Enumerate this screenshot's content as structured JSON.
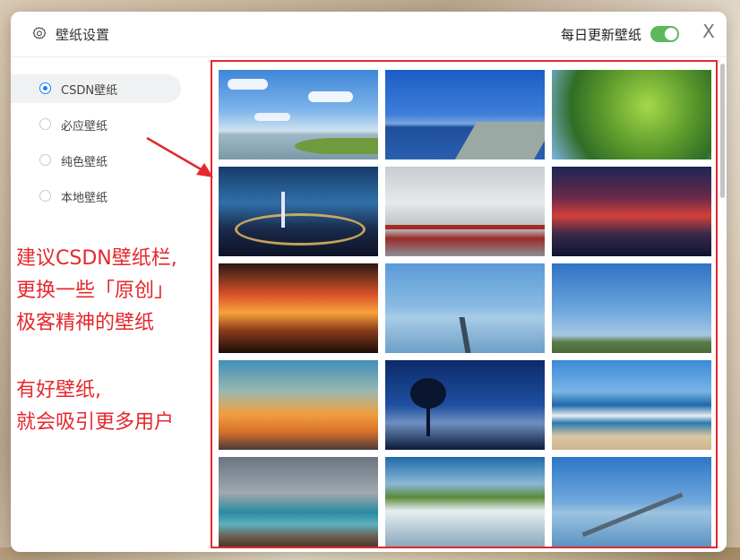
{
  "header": {
    "title": "壁纸设置",
    "daily_update_label": "每日更新壁纸",
    "daily_update_enabled": true,
    "close_glyph": "X"
  },
  "sidebar": {
    "items": [
      {
        "label": "CSDN壁纸",
        "selected": true
      },
      {
        "label": "必应壁纸",
        "selected": false
      },
      {
        "label": "纯色壁纸",
        "selected": false
      },
      {
        "label": "本地壁纸",
        "selected": false
      }
    ]
  },
  "annotation": {
    "lines": [
      "建议CSDN壁纸栏,",
      "更换一些「原创」",
      "极客精神的壁纸",
      "",
      "有好壁纸,",
      "就会吸引更多用户"
    ],
    "color": "#e4282d"
  },
  "gallery": {
    "thumbnails": [
      {
        "scene": "blue sky clouds over lake with reeds"
      },
      {
        "scene": "blue lake with shoreline road"
      },
      {
        "scene": "ginkgo leaves against sky"
      },
      {
        "scene": "night city interchange lights"
      },
      {
        "scene": "chinese pavilion red railing misty"
      },
      {
        "scene": "anime girl under red sunset clouds"
      },
      {
        "scene": "orange sunset with tree silhouettes"
      },
      {
        "scene": "bridge across calm sea"
      },
      {
        "scene": "blue sky with green hills"
      },
      {
        "scene": "orange sunset sky with contrail"
      },
      {
        "scene": "tree silhouette blue dusk"
      },
      {
        "scene": "beach waves with seagull"
      },
      {
        "scene": "stormy sea rocky coast"
      },
      {
        "scene": "island above clouds"
      },
      {
        "scene": "long bridge over blue sea"
      }
    ]
  },
  "colors": {
    "accent": "#1e7cf2",
    "toggle_on": "#5cb85c",
    "highlight_border": "#e4282d"
  }
}
